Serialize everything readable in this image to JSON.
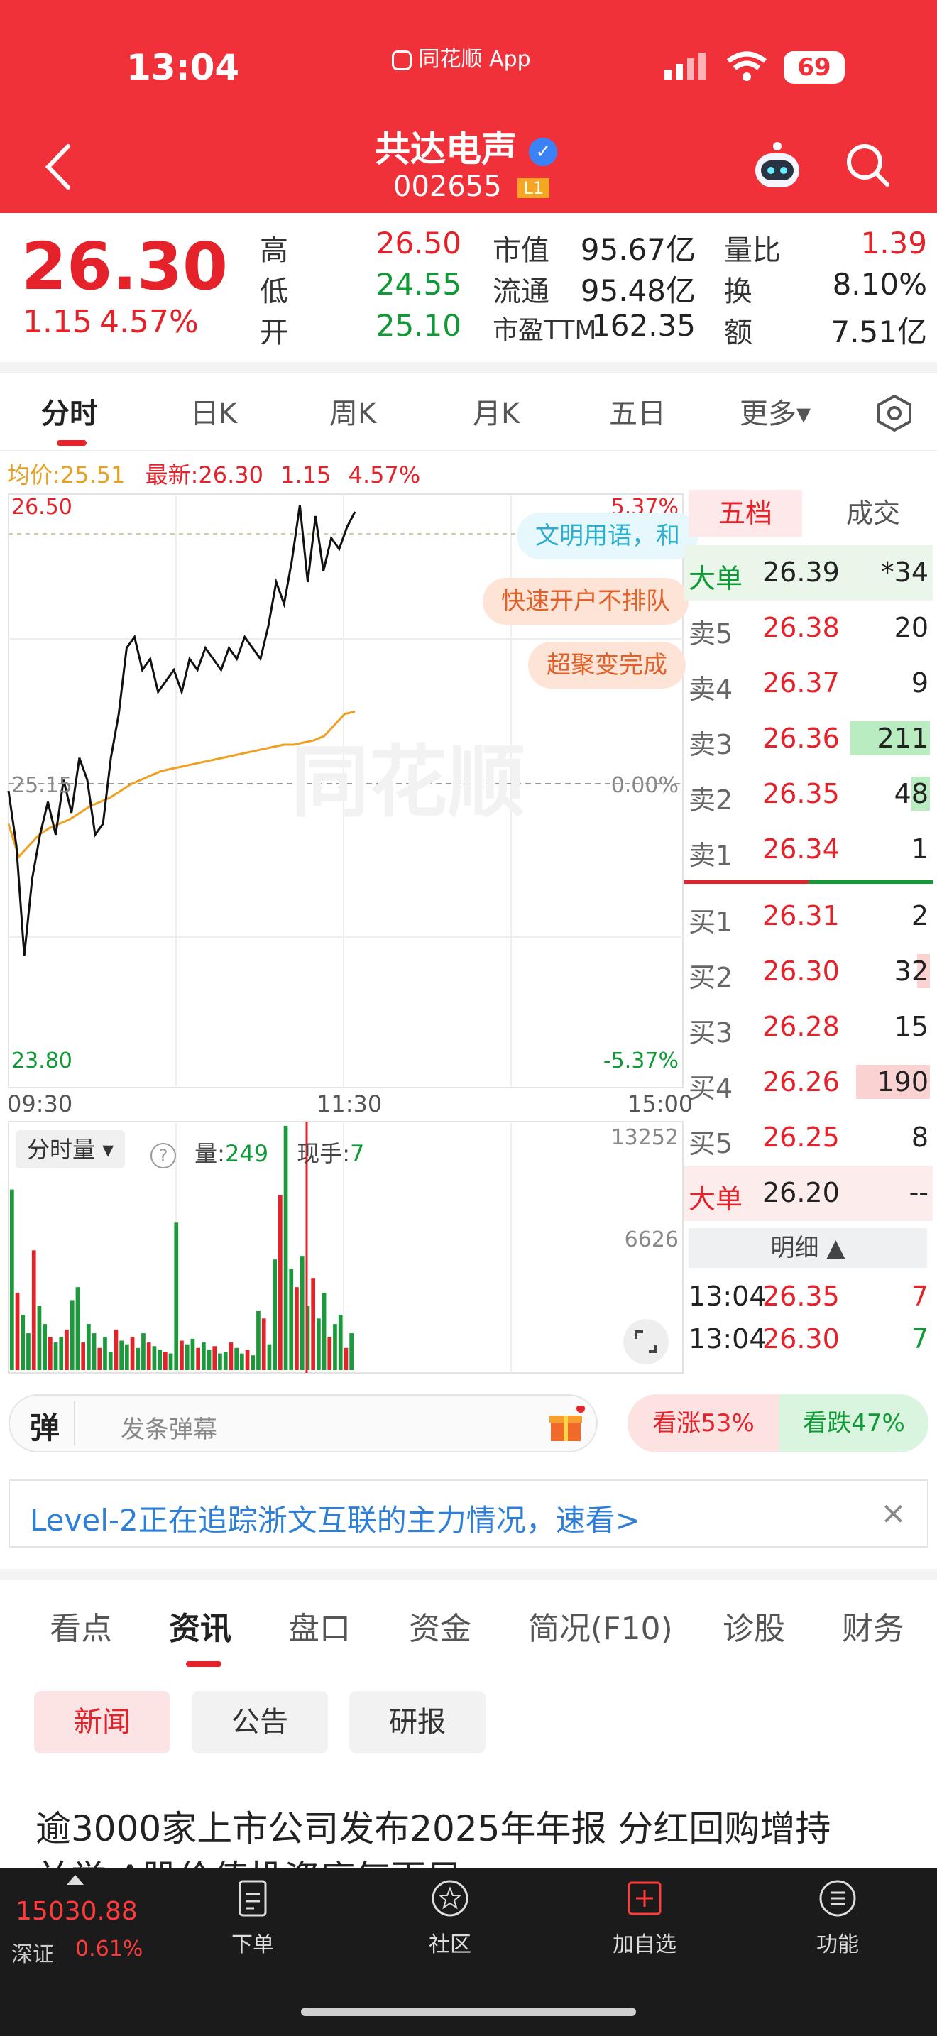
{
  "status_bar": {
    "time": "13:04",
    "app_label": "同花顺 App",
    "battery": "69"
  },
  "header": {
    "title": "共达电声",
    "code": "002655",
    "level_badge": "L1"
  },
  "quote": {
    "price": "26.30",
    "change": "1.15",
    "change_pct": "4.57%",
    "high_label": "高",
    "high": "26.50",
    "low_label": "低",
    "low": "24.55",
    "open_label": "开",
    "open": "25.10",
    "mktcap_label": "市值",
    "mktcap": "95.67亿",
    "float_label": "流通",
    "float": "95.48亿",
    "pe_label": "市盈TTM",
    "pe": "162.35",
    "volratio_label": "量比",
    "volratio": "1.39",
    "turnover_label": "换",
    "turnover": "8.10%",
    "amount_label": "额",
    "amount": "7.51亿"
  },
  "kline_tabs": [
    "分时",
    "日K",
    "周K",
    "月K",
    "五日",
    "更多▾"
  ],
  "chart_header": {
    "avg_label": "均价:",
    "avg": "25.51",
    "last_label": "最新:",
    "last": "26.30",
    "chg": "1.15",
    "chg_pct": "4.57%"
  },
  "chart_data": {
    "type": "line",
    "y_top": "26.50",
    "y_mid": "25.15",
    "y_bottom": "23.80",
    "pct_top": "5.37%",
    "pct_mid": "0.00%",
    "pct_bottom": "-5.37%",
    "x_ticks": [
      "09:30",
      "11:30",
      "15:00"
    ],
    "ylim": [
      23.8,
      26.5
    ],
    "price_series": [
      25.15,
      24.9,
      24.4,
      24.75,
      24.95,
      25.1,
      24.95,
      25.2,
      25.05,
      25.3,
      25.2,
      24.95,
      25.0,
      25.3,
      25.5,
      25.8,
      25.85,
      25.7,
      25.75,
      25.6,
      25.65,
      25.7,
      25.6,
      25.75,
      25.7,
      25.8,
      25.75,
      25.7,
      25.8,
      25.75,
      25.85,
      25.8,
      25.75,
      25.9,
      26.1,
      26.0,
      26.2,
      26.45,
      26.1,
      26.4,
      26.15,
      26.3,
      26.25,
      26.35,
      26.42
    ],
    "avg_series": [
      25.0,
      24.85,
      24.9,
      24.95,
      24.98,
      25.0,
      25.02,
      25.05,
      25.08,
      25.1,
      25.12,
      25.15,
      25.18,
      25.2,
      25.22,
      25.24,
      25.25,
      25.26,
      25.27,
      25.28,
      25.29,
      25.3,
      25.31,
      25.32,
      25.33,
      25.34,
      25.35,
      25.36,
      25.36,
      25.37,
      25.38,
      25.4,
      25.45,
      25.5,
      25.51
    ],
    "volume_max": "13252",
    "volume_mid": "6626",
    "volume_series": [
      9800,
      4200,
      3000,
      2000,
      6500,
      3500,
      2500,
      1800,
      1500,
      1800,
      2200,
      3800,
      4500,
      1500,
      2500,
      2000,
      1200,
      1800,
      1000,
      2200,
      1600,
      1400,
      1800,
      1200,
      2000,
      1500,
      1300,
      1100,
      1000,
      900,
      8000,
      1600,
      1400,
      1700,
      1200,
      1500,
      1100,
      1300,
      900,
      1000,
      1500,
      1200,
      900,
      1100,
      800,
      3200,
      2800,
      1400,
      6000,
      9500,
      13252,
      5500,
      4500,
      6200,
      3500,
      5000,
      2800,
      4200,
      1800,
      2500,
      3000,
      1200,
      2000
    ]
  },
  "volume_panel": {
    "selector": "分时量 ▾",
    "qty_label": "量:",
    "qty": "249",
    "hand_label": "现手:",
    "hand": "7"
  },
  "banners": [
    {
      "text": "文明用语，和"
    },
    {
      "text": "快速开户不排队"
    },
    {
      "text": "超聚变完成"
    }
  ],
  "orderbook": {
    "tabs": [
      "五档",
      "成交"
    ],
    "big_sell": {
      "label": "大单",
      "price": "26.39",
      "vol": "*34"
    },
    "sells": [
      {
        "label": "卖5",
        "price": "26.38",
        "vol": "20"
      },
      {
        "label": "卖4",
        "price": "26.37",
        "vol": "9"
      },
      {
        "label": "卖3",
        "price": "26.36",
        "vol": "211"
      },
      {
        "label": "卖2",
        "price": "26.35",
        "vol": "48"
      },
      {
        "label": "卖1",
        "price": "26.34",
        "vol": "1"
      }
    ],
    "buys": [
      {
        "label": "买1",
        "price": "26.31",
        "vol": "2"
      },
      {
        "label": "买2",
        "price": "26.30",
        "vol": "32"
      },
      {
        "label": "买3",
        "price": "26.28",
        "vol": "15"
      },
      {
        "label": "买4",
        "price": "26.26",
        "vol": "190"
      },
      {
        "label": "买5",
        "price": "26.25",
        "vol": "8"
      }
    ],
    "big_buy": {
      "label": "大单",
      "price": "26.20",
      "vol": "--"
    },
    "detail_label": "明细 ▲",
    "ticks": [
      {
        "time": "13:04",
        "price": "26.35",
        "vol": "7"
      },
      {
        "time": "13:04",
        "price": "26.30",
        "vol": "7"
      }
    ]
  },
  "danmu": {
    "icon": "弹",
    "placeholder": "发条弹幕"
  },
  "sentiment": {
    "up": "看涨53%",
    "down": "看跌47%"
  },
  "level2_banner": {
    "text": "Level-2正在追踪浙文互联的主力情况，速看>"
  },
  "info_tabs": [
    "看点",
    "资讯",
    "盘口",
    "资金",
    "简况(F10)",
    "诊股",
    "财务"
  ],
  "sub_tabs": [
    "新闻",
    "公告",
    "研报"
  ],
  "news": {
    "headline": "逾3000家上市公司发布2025年年报 分红回购增持",
    "headline_2": "并举 A股价值投资底气更足"
  },
  "bottom_nav": {
    "index_value": "15030.88",
    "index_name": "深证",
    "index_pct": "0.61%",
    "items": [
      "下单",
      "社区",
      "加自选",
      "功能"
    ]
  },
  "watermark": "同花顺",
  "colors": {
    "brand": "#f0313a",
    "up": "#e5212a",
    "down": "#0f9a36",
    "avg_line": "#f0a020"
  }
}
